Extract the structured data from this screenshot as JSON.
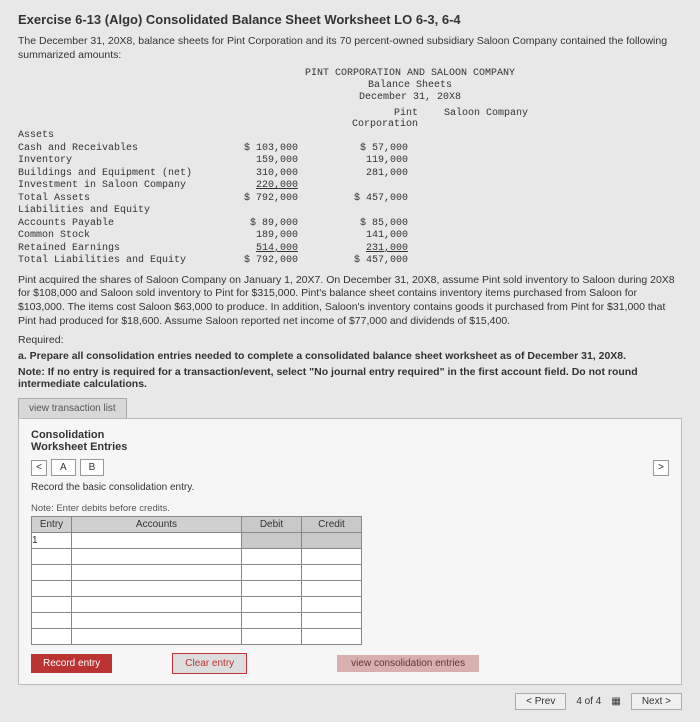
{
  "title": "Exercise 6-13 (Algo) Consolidated Balance Sheet Worksheet LO 6-3, 6-4",
  "intro": "The December 31, 20X8, balance sheets for Pint Corporation and its 70 percent-owned subsidiary Saloon Company contained the following summarized amounts:",
  "bs": {
    "h1": "PINT CORPORATION AND SALOON COMPANY",
    "h2": "Balance Sheets",
    "h3": "December 31, 20X8",
    "col1": "Pint Corporation",
    "col2": "Saloon Company",
    "sect1": "Assets",
    "r1l": "Cash and Receivables",
    "r1a": "$ 103,000",
    "r1b": "$ 57,000",
    "r2l": "Inventory",
    "r2a": "159,000",
    "r2b": "119,000",
    "r3l": "Buildings and Equipment (net)",
    "r3a": "310,000",
    "r3b": "281,000",
    "r4l": "Investment in Saloon Company",
    "r4a": "220,000",
    "r4b": "",
    "r5l": "Total Assets",
    "r5a": "$ 792,000",
    "r5b": "$ 457,000",
    "sect2": "Liabilities and Equity",
    "r6l": "Accounts Payable",
    "r6a": "$ 89,000",
    "r6b": "$ 85,000",
    "r7l": "Common Stock",
    "r7a": "189,000",
    "r7b": "141,000",
    "r8l": "Retained Earnings",
    "r8a": "514,000",
    "r8b": "231,000",
    "r9l": "Total Liabilities and Equity",
    "r9a": "$ 792,000",
    "r9b": "$ 457,000"
  },
  "para": "Pint acquired the shares of Saloon Company on January 1, 20X7. On December 31, 20X8, assume Pint sold inventory to Saloon during 20X8 for $108,000 and Saloon sold inventory to Pint for $315,000. Pint's balance sheet contains inventory items purchased from Saloon for $103,000. The items cost Saloon $63,000 to produce. In addition, Saloon's inventory contains goods it purchased from Pint for $31,000 that Pint had produced for $18,600. Assume Saloon reported net income of $77,000 and dividends of $15,400.",
  "required": "Required:",
  "reqA": "a. Prepare all consolidation entries needed to complete a consolidated balance sheet worksheet as of December 31, 20X8.",
  "noteStr": "Note: If no entry is required for a transaction/event, select \"No journal entry required\" in the first account field. Do not round intermediate calculations.",
  "tab": "view transaction list",
  "wsTitle1": "Consolidation",
  "wsTitle2": "Worksheet Entries",
  "tabA": "A",
  "tabB": "B",
  "rec": "Record the basic consolidation entry.",
  "tblnote": "Note: Enter debits before credits.",
  "th": {
    "entry": "Entry",
    "acc": "Accounts",
    "debit": "Debit",
    "credit": "Credit"
  },
  "row1entry": "1",
  "btnRecord": "Record entry",
  "btnClear": "Clear entry",
  "linkView": "view consolidation entries",
  "prev": "< Prev",
  "pageInd": "4 of 4",
  "next": "Next >"
}
